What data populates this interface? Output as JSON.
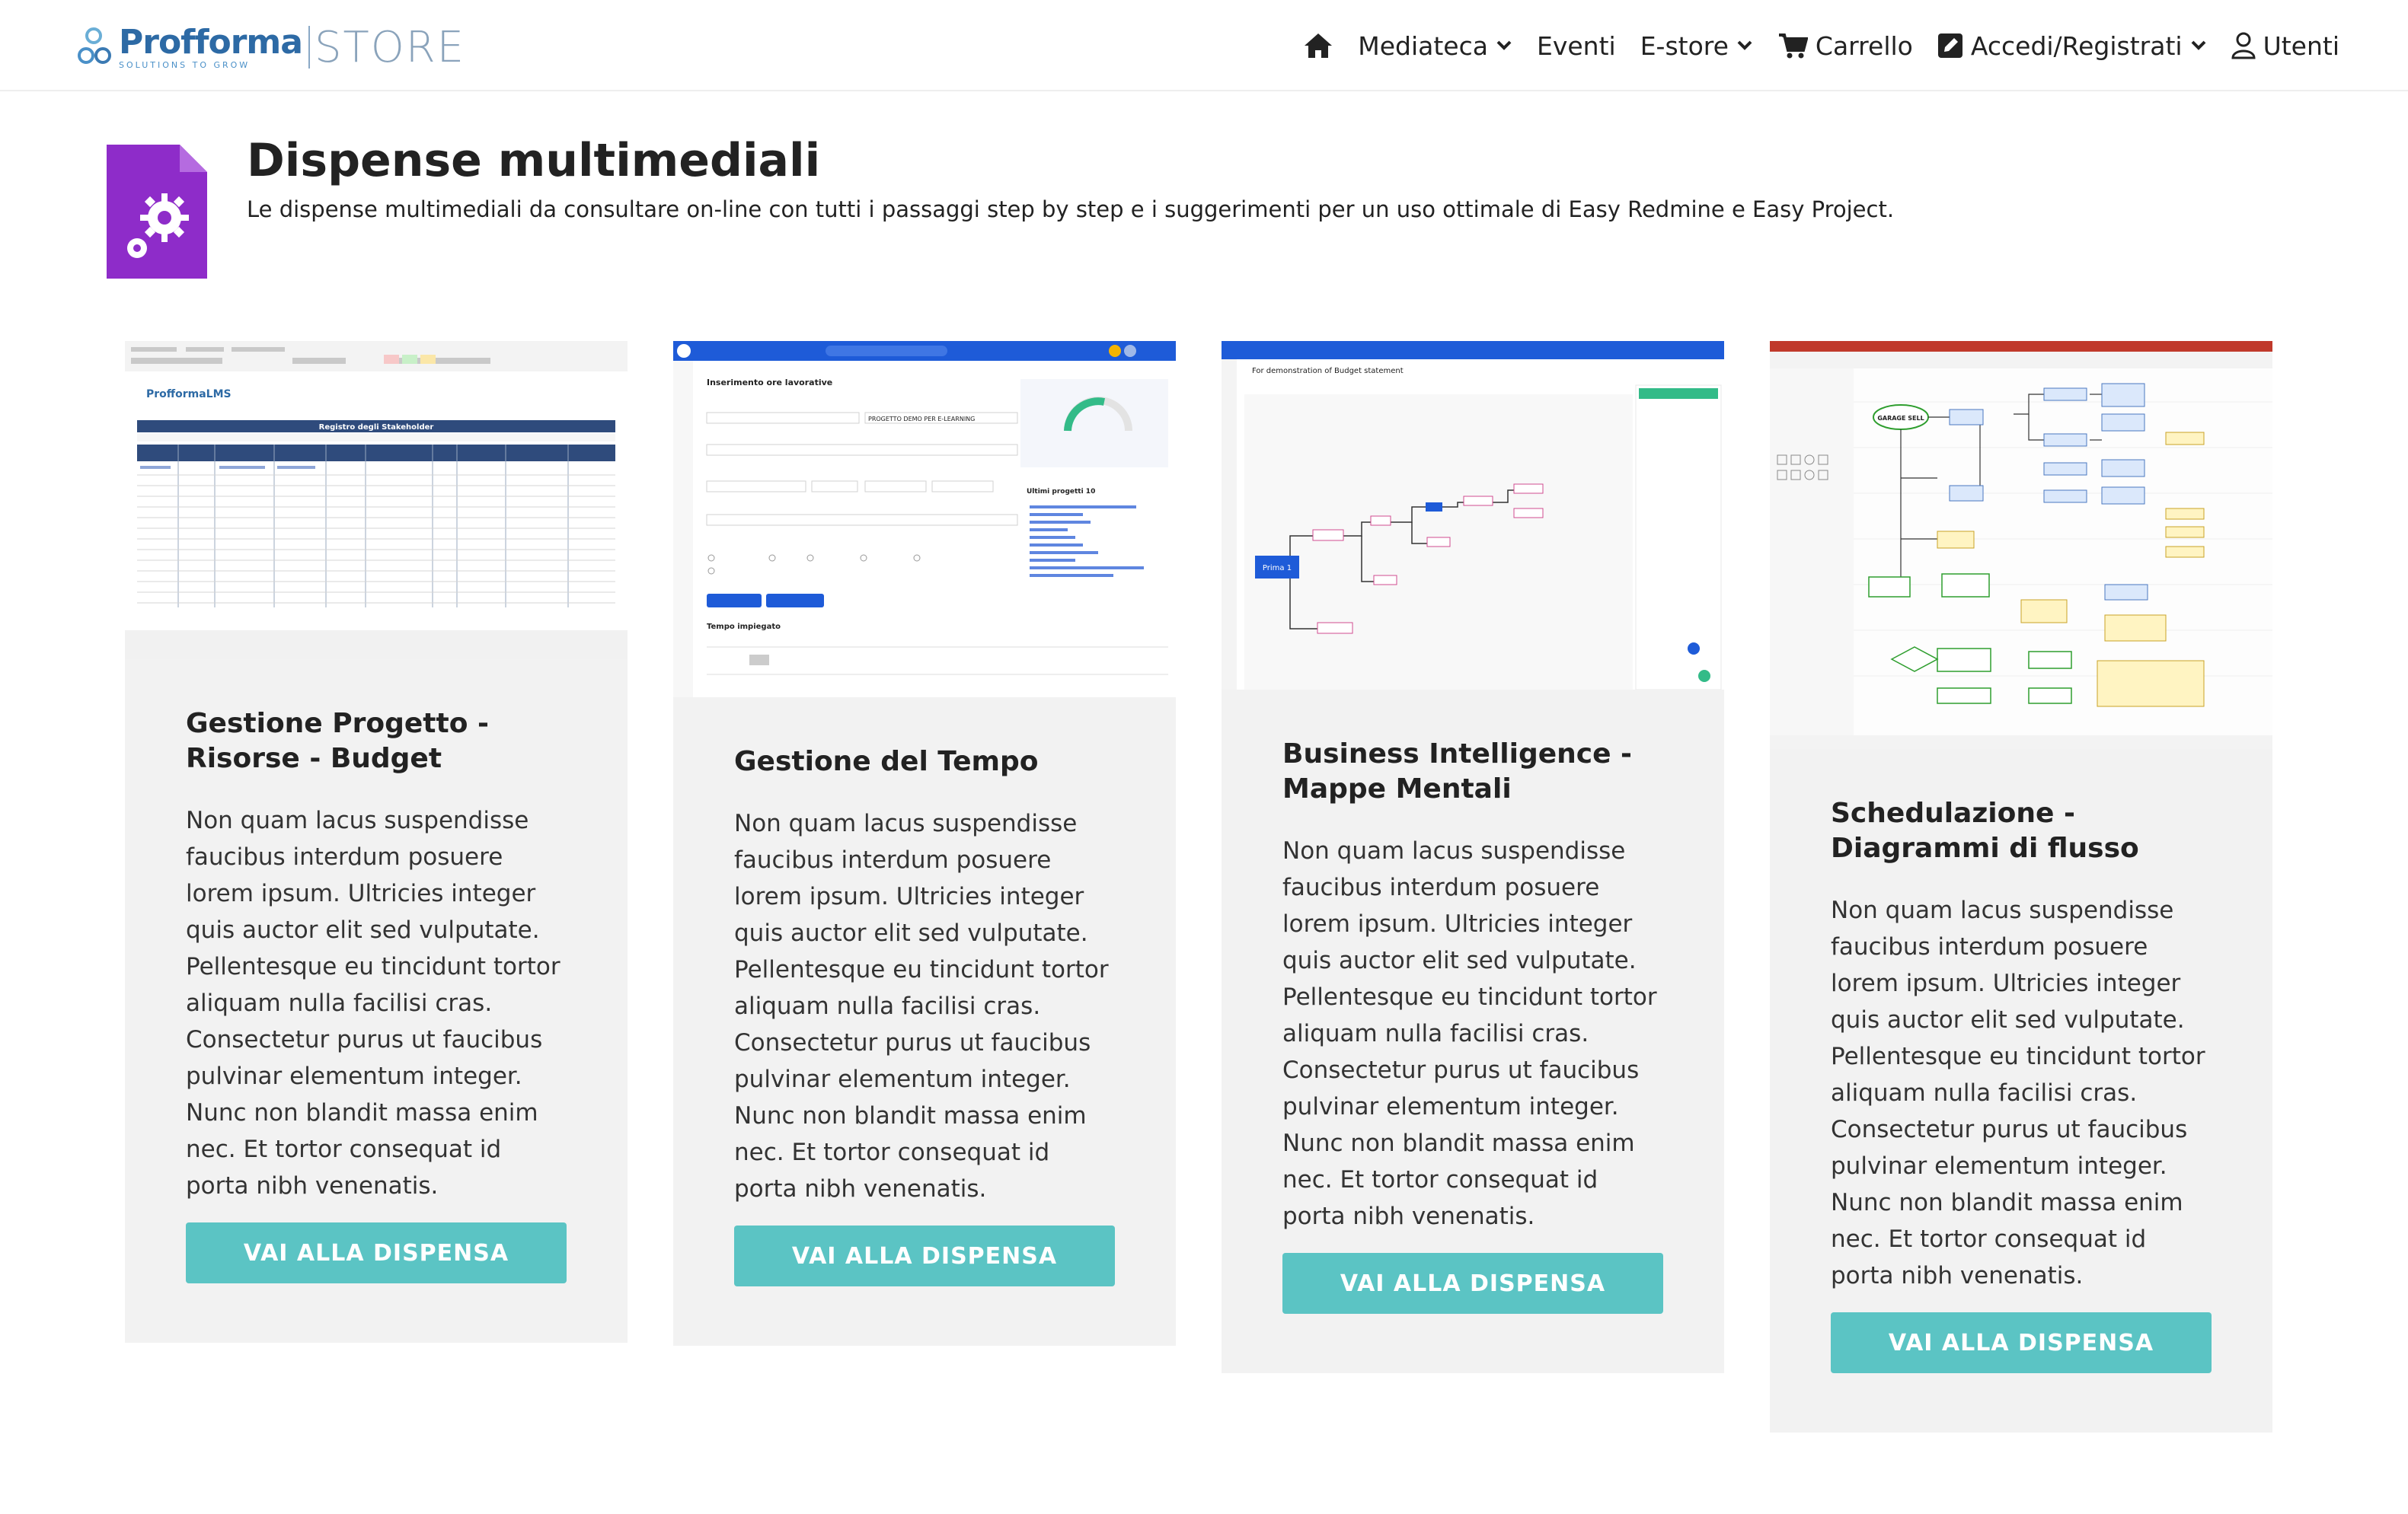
{
  "header": {
    "brand": "Profforma",
    "tagline": "SOLUTIONS TO GROW",
    "store": "STORE",
    "nav": {
      "home_icon": "home-icon",
      "mediateca": "Mediateca",
      "eventi": "Eventi",
      "estore": "E-store",
      "carrello": "Carrello",
      "accedi": "Accedi/Registrati",
      "utenti": "Utenti"
    }
  },
  "intro": {
    "title": "Dispense multimediali",
    "description": "Le dispense multimediali da consultare on-line con tutti i passaggi step by step e i suggerimenti per un uso ottimale di Easy Redmine e Easy Project.",
    "icon": "document-gear-icon",
    "icon_color": "#8e2cc9"
  },
  "cards": [
    {
      "title": "Gestione Progetto - Risorse - Budget",
      "text": "Non quam lacus suspendisse faucibus interdum posuere lorem ipsum. Ultricies integer quis auctor elit sed vulputate. Pellentesque eu tincidunt tortor aliquam nulla facilisi cras. Consectetur purus ut faucibus pulvinar elementum integer. Nunc non blandit massa enim nec. Et tortor consequat id porta nibh venenatis.",
      "button": "VAI ALLA DISPENSA",
      "thumb_heading": "Registro degli Stakeholder",
      "thumb_logo": "ProfformaLMS"
    },
    {
      "title": "Gestione del Tempo",
      "text": "Non quam lacus suspendisse faucibus interdum posuere lorem ipsum. Ultricies integer quis auctor elit sed vulputate. Pellentesque eu tincidunt tortor aliquam nulla facilisi cras. Consectetur purus ut faucibus pulvinar elementum integer. Nunc non blandit massa enim nec. Et tortor consequat id porta nibh venenatis.",
      "button": "VAI ALLA DISPENSA",
      "thumb_heading": "Inserimento ore lavorative",
      "thumb_section": "Tempo impiegato",
      "thumb_recent": "Ultimi progetti 10",
      "thumb_project": "PROGETTO DEMO PER E-LEARNING"
    },
    {
      "title": "Business Intelligence - Mappe Mentali",
      "text": "Non quam lacus suspendisse faucibus interdum posuere lorem ipsum. Ultricies integer quis auctor elit sed vulputate. Pellentesque eu tincidunt tortor aliquam nulla facilisi cras. Consectetur purus ut faucibus pulvinar elementum integer. Nunc non blandit massa enim nec. Et tortor consequat id porta nibh venenatis.",
      "button": "VAI ALLA DISPENSA",
      "thumb_heading": "For demonstration of Budget statement",
      "thumb_root": "Prima 1"
    },
    {
      "title": "Schedulazione - Diagrammi di flusso",
      "text": "Non quam lacus suspendisse faucibus interdum posuere lorem ipsum. Ultricies integer quis auctor elit sed vulputate. Pellentesque eu tincidunt tortor aliquam nulla facilisi cras. Consectetur purus ut faucibus pulvinar elementum integer. Nunc non blandit massa enim nec. Et tortor consequat id porta nibh venenatis.",
      "button": "VAI ALLA DISPENSA",
      "thumb_start": "GARAGE SELL"
    }
  ],
  "colors": {
    "accent": "#5bc4c4",
    "card_bg": "#f2f2f2",
    "brand_blue": "#2d6aa5",
    "header_blue": "#2f4b7c",
    "app_blue": "#1e5bd8"
  }
}
